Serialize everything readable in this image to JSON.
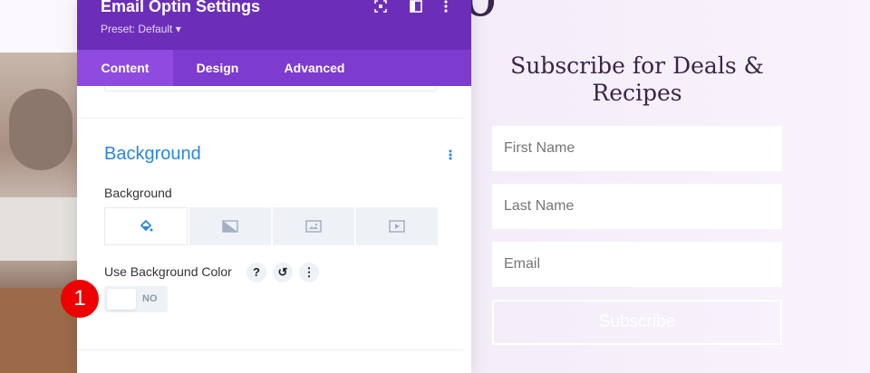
{
  "panel": {
    "title": "Email Optin Settings",
    "preset": "Preset: Default ▾",
    "header_icons": [
      "focus-icon",
      "split-view-icon",
      "more-vertical-icon"
    ],
    "tabs": [
      {
        "label": "Content",
        "active": true
      },
      {
        "label": "Design",
        "active": false
      },
      {
        "label": "Advanced",
        "active": false
      }
    ],
    "section": {
      "title": "Background",
      "field_label": "Background",
      "background_types": [
        "color-fill-icon",
        "gradient-icon",
        "image-icon",
        "video-icon"
      ],
      "option_label": "Use Background Color",
      "option_icons": {
        "help": "?",
        "reset": "↺",
        "more": "⋮"
      },
      "toggle_text": "NO",
      "toggle_on": false
    }
  },
  "step_badge": "1",
  "page": {
    "subscribe_title": "Subscribe for Deals & Recipes",
    "fields": [
      {
        "placeholder": "First Name"
      },
      {
        "placeholder": "Last Name"
      },
      {
        "placeholder": "Email"
      }
    ],
    "button_label": "Subscribe"
  },
  "colors": {
    "header": "#6c2eb9",
    "tabs": "#7d3bcf",
    "accent_blue": "#2b87da",
    "badge": "#ee0000"
  }
}
